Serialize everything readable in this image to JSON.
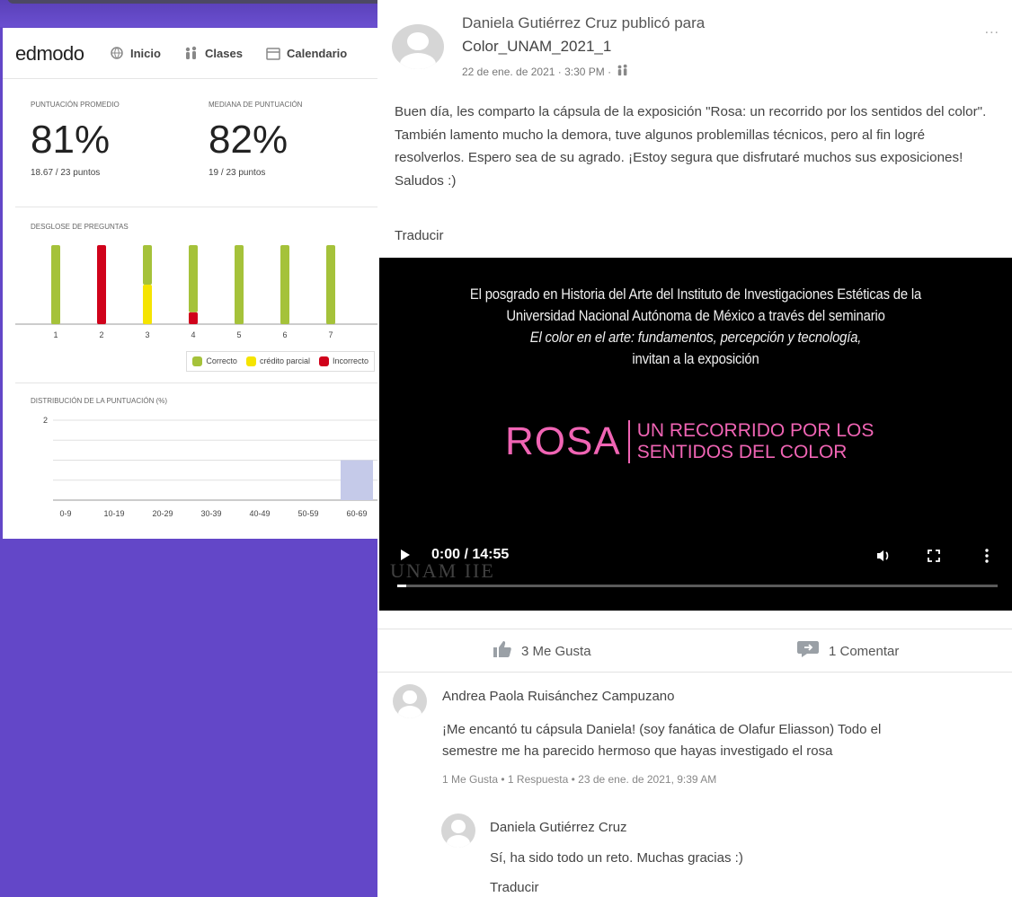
{
  "edmodo": {
    "logo": "edmodo",
    "nav": [
      {
        "label": "Inicio",
        "icon": "globe-icon"
      },
      {
        "label": "Clases",
        "icon": "people-icon"
      },
      {
        "label": "Calendario",
        "icon": "calendar-icon"
      }
    ],
    "scores": {
      "average_label": "PUNTUACIÓN PROMEDIO",
      "average_value": "81%",
      "average_points": "18.67 / 23 puntos",
      "median_label": "MEDIANA DE PUNTUACIÓN",
      "median_value": "82%",
      "median_points": "19 / 23 puntos"
    },
    "questions_title": "DESGLOSE DE PREGUNTAS",
    "distribution_title": "DISTRIBUCIÓN DE LA PUNTUACIÓN (%)",
    "legend": {
      "correct": "Correcto",
      "partial": "crédito parcial",
      "incorrect": "Incorrecto"
    },
    "colors": {
      "correct": "#a5c23a",
      "partial": "#f5e400",
      "incorrect": "#d0021b",
      "dist_bar": "#c5cae9"
    }
  },
  "chart_data": [
    {
      "type": "bar",
      "title": "DESGLOSE DE PREGUNTAS",
      "categories": [
        "1",
        "2",
        "3",
        "4",
        "5",
        "6",
        "7"
      ],
      "series": [
        {
          "name": "Correcto",
          "values": [
            1,
            0,
            0.5,
            0.85,
            1,
            1,
            1
          ]
        },
        {
          "name": "crédito parcial",
          "values": [
            0,
            0,
            0.5,
            0,
            0,
            0,
            0
          ]
        },
        {
          "name": "Incorrecto",
          "values": [
            0,
            1,
            0,
            0.15,
            0,
            0,
            0
          ]
        }
      ],
      "stacked": true,
      "ylim": [
        0,
        1
      ]
    },
    {
      "type": "bar",
      "title": "DISTRIBUCIÓN DE LA PUNTUACIÓN (%)",
      "categories": [
        "0-9",
        "10-19",
        "20-29",
        "30-39",
        "40-49",
        "50-59",
        "60-69"
      ],
      "values": [
        0,
        0,
        0,
        0,
        0,
        0,
        1
      ],
      "ylim": [
        0,
        2
      ],
      "yticks": [
        "2"
      ]
    }
  ],
  "post": {
    "author": "Daniela Gutiérrez Cruz publicó para",
    "group": "Color_UNAM_2021_1",
    "date": "22 de ene. de 2021 · 3:30 PM ·",
    "more": "...",
    "body": "Buen día, les comparto la cápsula de la exposición \"Rosa: un recorrido por los sentidos del color\". También lamento mucho la demora, tuve algunos problemillas técnicos, pero al fin logré resolverlos. Espero sea de su agrado. ¡Estoy segura que disfrutaré muchos sus exposiciones! Saludos :)",
    "translate": "Traducir",
    "video": {
      "line1": "El posgrado en Historia del Arte del Instituto de Investigaciones Estéticas de la",
      "line2": "Universidad Nacional Autónoma de México a través del seminario",
      "line3": "El color en el arte: fundamentos, percepción y tecnología,",
      "line4": "invitan a la exposición",
      "title_big": "ROSA",
      "title_small1": "UN RECORRIDO POR LOS",
      "title_small2": "SENTIDOS DEL COLOR",
      "time": "0:00 / 14:55",
      "progress": 0.0,
      "watermark": "UNAM IIE"
    },
    "likes": "3 Me Gusta",
    "comments": "1 Comentar"
  },
  "comment": {
    "author": "Andrea Paola Ruisánchez Campuzano",
    "text_line1": "¡Me encantó tu cápsula Daniela! (soy fanática de Olafur Eliasson) Todo el",
    "text_line2": "semestre me ha parecido hermoso que hayas investigado el rosa",
    "meta": "1 Me Gusta  •  1 Respuesta  •  23 de ene. de 2021, 9:39 AM"
  },
  "reply": {
    "author": "Daniela Gutiérrez Cruz",
    "text": "Sí, ha sido todo un reto. Muchas gracias :)",
    "translate": "Traducir"
  }
}
